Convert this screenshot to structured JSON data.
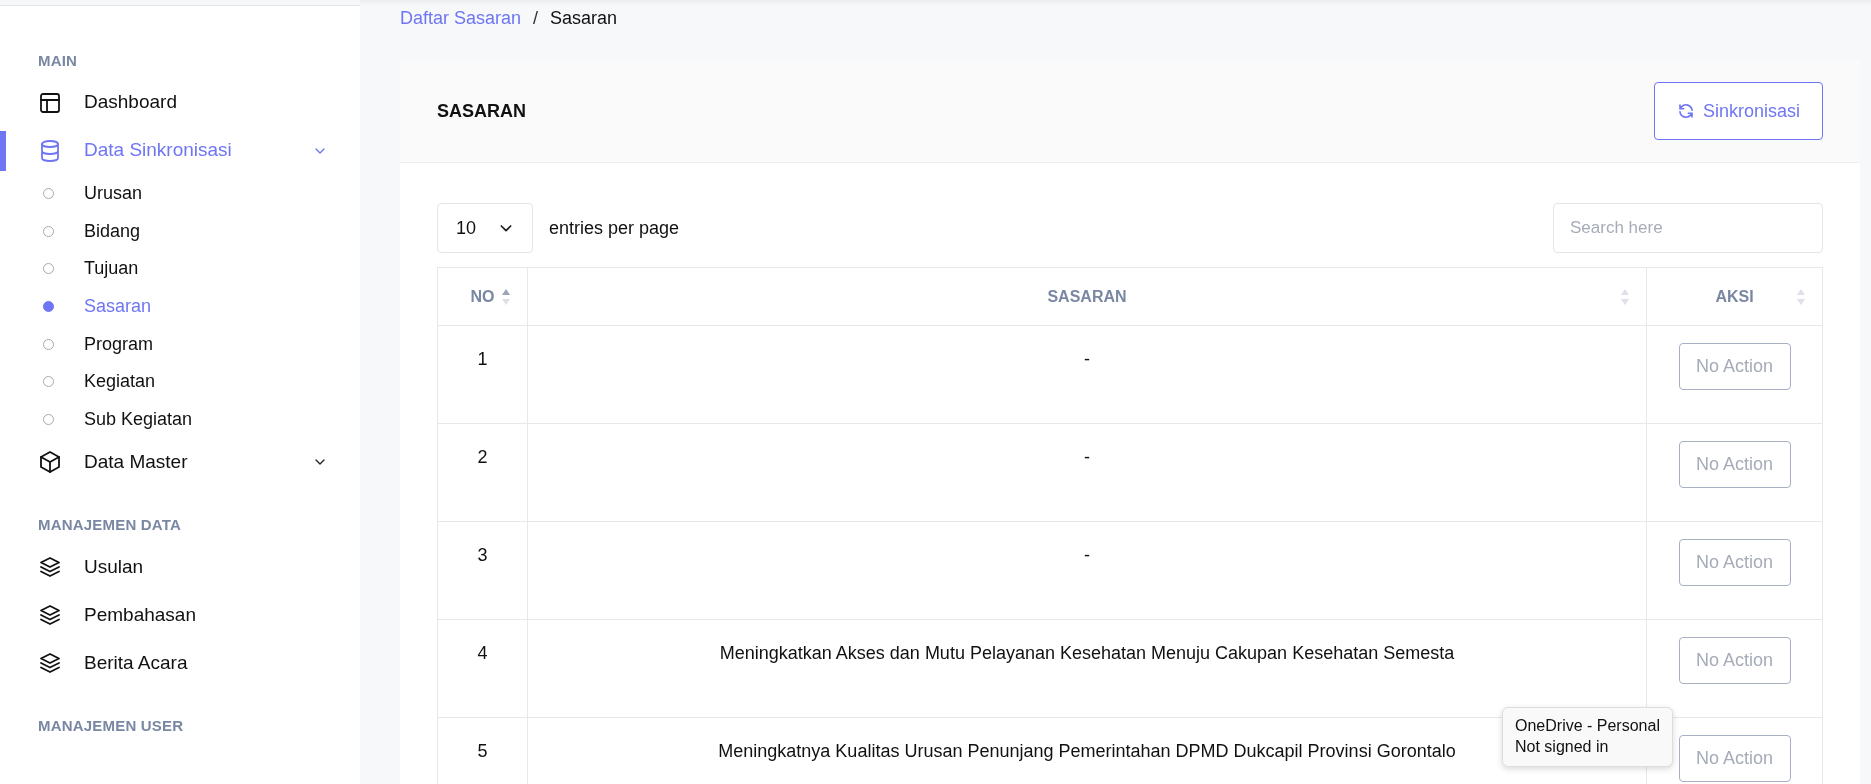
{
  "sidebar": {
    "sections": [
      {
        "heading": "MAIN",
        "items": [
          {
            "label": "Dashboard",
            "selected": false
          },
          {
            "label": "Data Sinkronisasi",
            "selected": true,
            "expanded": true,
            "children": [
              {
                "label": "Urusan",
                "selected": false
              },
              {
                "label": "Bidang",
                "selected": false
              },
              {
                "label": "Tujuan",
                "selected": false
              },
              {
                "label": "Sasaran",
                "selected": true
              },
              {
                "label": "Program",
                "selected": false
              },
              {
                "label": "Kegiatan",
                "selected": false
              },
              {
                "label": "Sub Kegiatan",
                "selected": false
              }
            ]
          },
          {
            "label": "Data Master",
            "selected": false,
            "expanded": false
          }
        ]
      },
      {
        "heading": "MANAJEMEN DATA",
        "items": [
          {
            "label": "Usulan",
            "selected": false
          },
          {
            "label": "Pembahasan",
            "selected": false
          },
          {
            "label": "Berita Acara",
            "selected": false
          }
        ]
      },
      {
        "heading": "MANAJEMEN USER"
      }
    ]
  },
  "breadcrumb": {
    "separator": "/",
    "items": [
      {
        "label": "Daftar Sasaran",
        "link": true
      },
      {
        "label": "Sasaran",
        "link": false
      }
    ]
  },
  "card": {
    "title": "SASARAN",
    "sync_button": "Sinkronisasi",
    "page_size": "10",
    "entries_label": "entries per page",
    "search": {
      "placeholder": "Search here"
    },
    "table": {
      "columns": [
        {
          "label": "NO",
          "sorted_ascending": true
        },
        {
          "label": "SASARAN",
          "sorted_ascending": false
        },
        {
          "label": "AKSI",
          "sorted_ascending": false
        }
      ],
      "rows": [
        {
          "no": "1",
          "sasaran": "-",
          "action": "No Action"
        },
        {
          "no": "2",
          "sasaran": "-",
          "action": "No Action"
        },
        {
          "no": "3",
          "sasaran": "-",
          "action": "No Action"
        },
        {
          "no": "4",
          "sasaran": "Meningkatkan Akses dan Mutu Pelayanan Kesehatan Menuju Cakupan Kesehatan Semesta",
          "action": "No Action"
        },
        {
          "no": "5",
          "sasaran": "Meningkatnya Kualitas Urusan Penunjang Pemerintahan DPMD Dukcapil Provinsi Gorontalo",
          "action": "No Action"
        }
      ]
    }
  },
  "tooltip": {
    "lines": [
      "OneDrive - Personal",
      "Not signed in"
    ]
  }
}
